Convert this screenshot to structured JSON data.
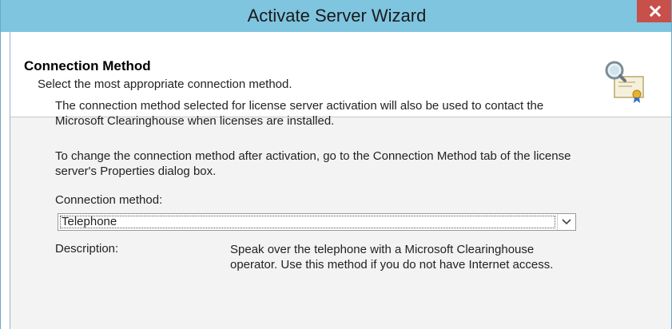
{
  "window": {
    "title": "Activate Server Wizard",
    "close_label": "x"
  },
  "header": {
    "title": "Connection Method",
    "subtitle": "Select the most appropriate connection method.",
    "icon": "certificate-magnifier-icon"
  },
  "body": {
    "paragraph1": "The connection method selected for license server activation will also be used to contact the Microsoft Clearinghouse when licenses are installed.",
    "paragraph2": "To change the connection method after activation, go to the Connection Method tab of the license server's Properties dialog box.",
    "connection_label": "Connection method:",
    "connection_value": "Telephone",
    "description_label": "Description:",
    "description_text": "Speak over the telephone with a Microsoft Clearinghouse operator. Use this method if you do not have Internet access."
  },
  "colors": {
    "titlebar": "#7fc5e0",
    "close_button": "#c7504a",
    "body_background": "#f3f3f3"
  }
}
